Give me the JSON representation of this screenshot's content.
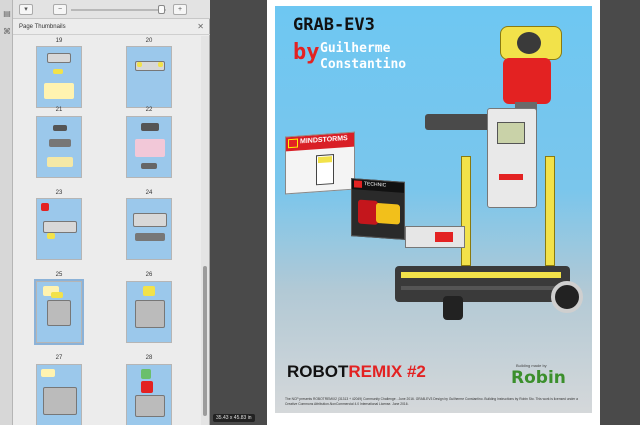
{
  "sidebar": {
    "title": "Page Thumbnails",
    "close_glyph": "✕",
    "rail_icons": [
      "page-thumbnails-icon",
      "attachment-icon"
    ],
    "toolbar": {
      "icons": [
        "options-icon",
        "zoom-out-icon",
        "zoom-in-icon"
      ]
    },
    "thumbnails": [
      {
        "page": "19",
        "selected": false
      },
      {
        "page": "20",
        "selected": false
      },
      {
        "page": "21",
        "selected": false
      },
      {
        "page": "22",
        "selected": false
      },
      {
        "page": "23",
        "selected": false
      },
      {
        "page": "24",
        "selected": false
      },
      {
        "page": "25",
        "selected": true
      },
      {
        "page": "26",
        "selected": false
      },
      {
        "page": "27",
        "selected": false
      },
      {
        "page": "28",
        "selected": false
      }
    ]
  },
  "document": {
    "title_line1": "GRAB-EV3",
    "by": "by",
    "author_line1": "Guilherme",
    "author_line2": "Constantino",
    "box1_label": "MINDSTORMS",
    "box2_label": "TECHNIC",
    "brand_part1": "ROBOT",
    "brand_part2": "REMIX",
    "brand_part3": " #2",
    "building_text": "Building      made by",
    "builder_name": "Robin",
    "credits": "The NCP presents ROBOTREMIX2 (31313 + 42049) Community Challenge - June 2016.  GRAB-EV3 Design by Guilherme Constantino.  Building Instructions by Robin Sto. This work is licensed under a Creative Commons Attribution-NonCommercial 4.0 International License. June 2016."
  },
  "status": {
    "page_size": "35.43 x 45.83 in"
  },
  "colors": {
    "poster_sky": "#6ec7f2",
    "accent_red": "#e32222",
    "lego_yellow": "#fff200",
    "builder_green": "#3b8f2c"
  }
}
